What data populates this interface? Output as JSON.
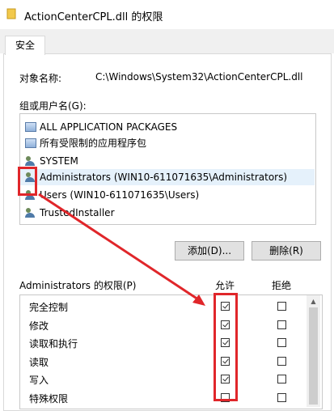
{
  "window": {
    "title": "ActionCenterCPL.dll 的权限"
  },
  "tabs": [
    {
      "label": "安全"
    }
  ],
  "object": {
    "label": "对象名称:",
    "value": "C:\\Windows\\System32\\ActionCenterCPL.dll"
  },
  "groups": {
    "label": "组或用户名(G):",
    "items": [
      {
        "label": "ALL APPLICATION PACKAGES",
        "icon": "package-icon"
      },
      {
        "label": "所有受限制的应用程序包",
        "icon": "package-icon"
      },
      {
        "label": "SYSTEM",
        "icon": "user-group-icon"
      },
      {
        "label": "Administrators (WIN10-611071635\\Administrators)",
        "icon": "user-group-icon",
        "selected": true
      },
      {
        "label": "Users (WIN10-611071635\\Users)",
        "icon": "user-group-icon"
      },
      {
        "label": "TrustedInstaller",
        "icon": "user-group-icon"
      }
    ]
  },
  "buttons": {
    "add": "添加(D)...",
    "remove": "删除(R)"
  },
  "permissions": {
    "label": "Administrators 的权限(P)",
    "allow_header": "允许",
    "deny_header": "拒绝",
    "rows": [
      {
        "name": "完全控制",
        "allow": true,
        "deny": false
      },
      {
        "name": "修改",
        "allow": true,
        "deny": false
      },
      {
        "name": "读取和执行",
        "allow": true,
        "deny": false
      },
      {
        "name": "读取",
        "allow": true,
        "deny": false
      },
      {
        "name": "写入",
        "allow": true,
        "deny": false
      },
      {
        "name": "特殊权限",
        "allow": false,
        "deny": false
      }
    ]
  },
  "colors": {
    "annotation": "#e0262a",
    "selection": "#e5f1fb"
  }
}
